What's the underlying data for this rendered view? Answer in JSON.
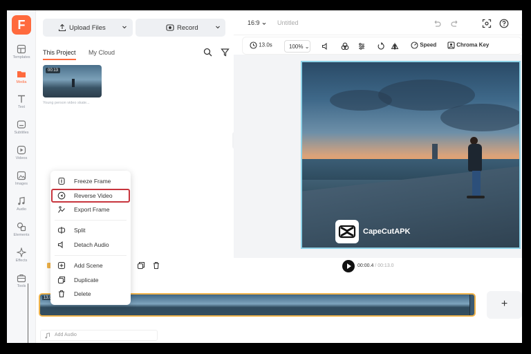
{
  "app": {
    "logo_letter": "F",
    "brand_color": "#ff6a3d"
  },
  "rail": {
    "items": [
      {
        "label": "Templates",
        "icon": "template-icon"
      },
      {
        "label": "Media",
        "icon": "media-folder-icon",
        "active": true
      },
      {
        "label": "Text",
        "icon": "text-icon"
      },
      {
        "label": "Subtitles",
        "icon": "subtitles-icon"
      },
      {
        "label": "Videos",
        "icon": "video-icon"
      },
      {
        "label": "Images",
        "icon": "image-icon"
      },
      {
        "label": "Audio",
        "icon": "music-note-icon"
      },
      {
        "label": "Elements",
        "icon": "shapes-icon"
      },
      {
        "label": "Effects",
        "icon": "sparkle-icon"
      },
      {
        "label": "Tools",
        "icon": "toolbox-icon"
      }
    ]
  },
  "media_panel": {
    "upload_label": "Upload Files",
    "record_label": "Record",
    "tabs": [
      {
        "label": "This Project",
        "active": true
      },
      {
        "label": "My Cloud"
      }
    ],
    "clip": {
      "duration": "00:13",
      "caption": "Young person video skate..."
    }
  },
  "context_menu": {
    "items": [
      {
        "label": "Freeze Frame",
        "icon": "freeze-icon"
      },
      {
        "label": "Reverse Video",
        "icon": "reverse-icon",
        "highlighted": true
      },
      {
        "label": "Export Frame",
        "icon": "export-frame-icon"
      },
      {
        "label": "Split",
        "icon": "split-icon"
      },
      {
        "label": "Detach Audio",
        "icon": "speaker-icon"
      },
      {
        "label": "Add Scene",
        "icon": "add-scene-icon"
      },
      {
        "label": "Duplicate",
        "icon": "duplicate-icon"
      },
      {
        "label": "Delete",
        "icon": "trash-icon"
      }
    ]
  },
  "preview": {
    "aspect_ratio": "16:9",
    "title": "Untitled",
    "toolbar": {
      "duration": "13.0s",
      "zoom": "100%",
      "speed_label": "Speed",
      "chroma_label": "Chroma Key"
    },
    "watermark_text": "CapeCutAPK"
  },
  "playback": {
    "current": "00:00.4",
    "total": "/ 00:13.0"
  },
  "timeline": {
    "clip_label": "13.0",
    "audio_label": "Add Audio",
    "add_label": "+"
  },
  "colors": {
    "highlight": "#c7343c",
    "selection": "#f0b34a",
    "preview_border": "#8fd3e8"
  }
}
